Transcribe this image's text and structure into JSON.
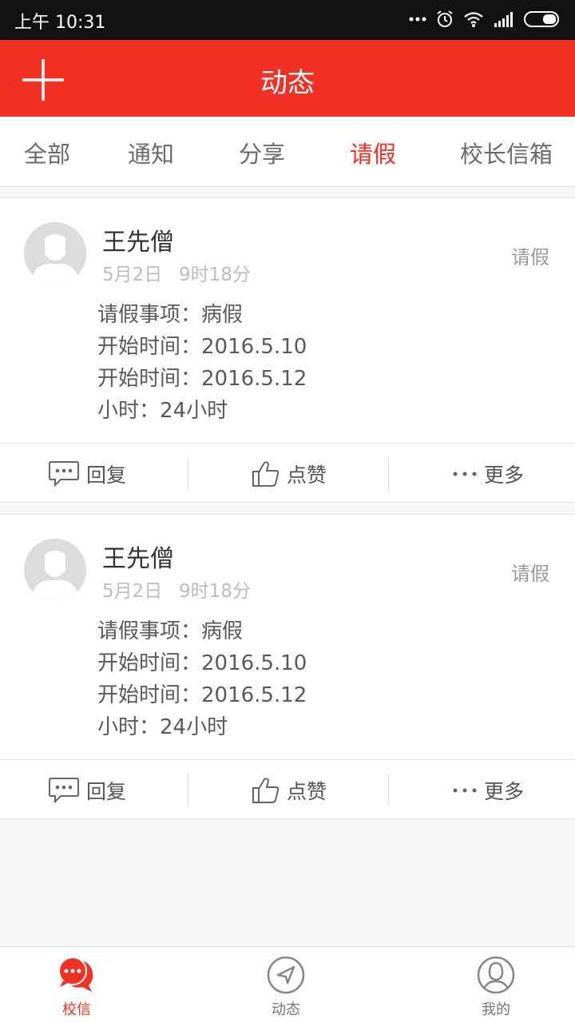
{
  "status_bar": {
    "time": "上午 10:31",
    "icons": [
      "more-dots-icon",
      "alarm-icon",
      "wifi-icon",
      "signal-icon",
      "battery-icon"
    ]
  },
  "header": {
    "title": "动态",
    "add_icon": "plus-icon"
  },
  "tabs": [
    {
      "label": "全部",
      "active": false
    },
    {
      "label": "通知",
      "active": false
    },
    {
      "label": "分享",
      "active": false
    },
    {
      "label": "请假",
      "active": true
    },
    {
      "label": "校长信箱",
      "active": false
    }
  ],
  "posts": [
    {
      "name": "王先僧",
      "date": "5月2日",
      "time": "9时18分",
      "tag": "请假",
      "lines": [
        "请假事项：病假",
        "开始时间：2016.5.10",
        "开始时间：2016.5.12",
        "小时：24小时"
      ],
      "actions": {
        "reply": "回复",
        "like": "点赞",
        "more": "更多"
      }
    },
    {
      "name": "王先僧",
      "date": "5月2日",
      "time": "9时18分",
      "tag": "请假",
      "lines": [
        "请假事项：病假",
        "开始时间：2016.5.10",
        "开始时间：2016.5.12",
        "小时：24小时"
      ],
      "actions": {
        "reply": "回复",
        "like": "点赞",
        "more": "更多"
      }
    }
  ],
  "bottom_nav": [
    {
      "label": "校信",
      "icon": "chat-bubble-icon",
      "active": true
    },
    {
      "label": "动态",
      "icon": "compass-icon",
      "active": false
    },
    {
      "label": "我的",
      "icon": "user-icon",
      "active": false
    }
  ],
  "colors": {
    "accent": "#f23024",
    "status_bar": "#121212",
    "background": "#f6f6f6"
  }
}
